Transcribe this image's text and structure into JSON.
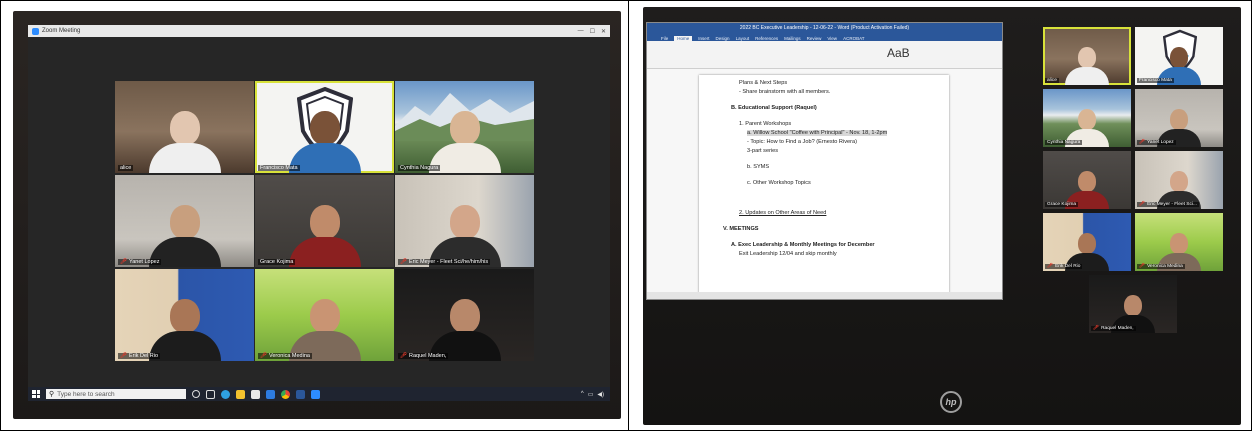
{
  "left_photo": {
    "window_title": "Zoom Meeting",
    "window_controls": [
      "—",
      "☐",
      "✕"
    ],
    "participants": [
      {
        "name": "alice",
        "muted": false,
        "active": false
      },
      {
        "name": "Francisco Mata",
        "muted": false,
        "active": true
      },
      {
        "name": "Cynthia Nagura",
        "muted": false,
        "active": false
      },
      {
        "name": "Yanet Lopez",
        "muted": true,
        "active": false
      },
      {
        "name": "Grace Kojima",
        "muted": false,
        "active": false
      },
      {
        "name": "Eric Meyer - Fleet Sci/he/him/his",
        "muted": true,
        "active": false
      },
      {
        "name": "Erik Del Rio",
        "muted": true,
        "active": false
      },
      {
        "name": "Veronica Medina",
        "muted": true,
        "active": false
      },
      {
        "name": "Raquel Maden,",
        "muted": true,
        "active": false
      }
    ],
    "taskbar": {
      "search_placeholder": "Type here to search",
      "icons": [
        "windows-start-icon",
        "cortana-icon",
        "task-view-icon",
        "edge-icon",
        "file-explorer-icon",
        "store-icon",
        "mail-icon",
        "chrome-icon",
        "word-icon",
        "zoom-icon"
      ]
    }
  },
  "right_photo": {
    "word_window": {
      "title": "2022 BC Executive Leadership - 12-06-22 - Word (Product Activation Failed)",
      "tabs": [
        "File",
        "Home",
        "Insert",
        "Design",
        "Layout",
        "References",
        "Mailings",
        "Review",
        "View",
        "ACROBAT"
      ],
      "active_tab": "Home",
      "style_sample": "AaB",
      "document_lines": [
        {
          "text": "Plans & Next Steps",
          "level": 2,
          "style": "normal"
        },
        {
          "text": "- Share brainstorm with all members.",
          "level": 2,
          "style": "normal"
        },
        {
          "text": "B.  Educational Support  (Raquel)",
          "level": 1,
          "style": "heading"
        },
        {
          "text": "1. Parent Workshops",
          "level": 2,
          "style": "normal"
        },
        {
          "text": "a.  Willow School \"Coffee with Principal\" - Nov. 18, 1-2pm",
          "level": 3,
          "style": "highlight"
        },
        {
          "text": "- Topic: How to Find a Job? (Ernesto Rivera)",
          "level": 3,
          "style": "normal"
        },
        {
          "text": "3-part series",
          "level": 3,
          "style": "normal"
        },
        {
          "text": "b.  SYMS",
          "level": 3,
          "style": "normal"
        },
        {
          "text": "c.  Other Workshop Topics",
          "level": 3,
          "style": "normal"
        },
        {
          "text": "2.  Updates on Other Areas of Need",
          "level": 2,
          "style": "underline"
        },
        {
          "text": "V.  MEETINGS",
          "level": 0,
          "style": "heading"
        },
        {
          "text": "A.  Exec Leadership & Monthly Meetings for December",
          "level": 1,
          "style": "heading"
        },
        {
          "text": "Exit Leadership 12/04 and skip monthly",
          "level": 2,
          "style": "normal"
        }
      ]
    },
    "gallery": [
      {
        "name": "alice",
        "muted": false,
        "active": true
      },
      {
        "name": "Francisco Mata",
        "muted": false,
        "active": false
      },
      {
        "name": "Cynthia Nagura",
        "muted": false,
        "active": false
      },
      {
        "name": "Yanet Lopez",
        "muted": true,
        "active": false
      },
      {
        "name": "Grace Kojima",
        "muted": false,
        "active": false
      },
      {
        "name": "Eric Meyer - Fleet Sci...",
        "muted": true,
        "active": false
      },
      {
        "name": "Erik Del Rio",
        "muted": true,
        "active": false
      },
      {
        "name": "Veronica Medina",
        "muted": true,
        "active": false
      },
      {
        "name": "Raquel Maden,",
        "muted": true,
        "active": false
      }
    ],
    "monitor_brand": "hp"
  }
}
